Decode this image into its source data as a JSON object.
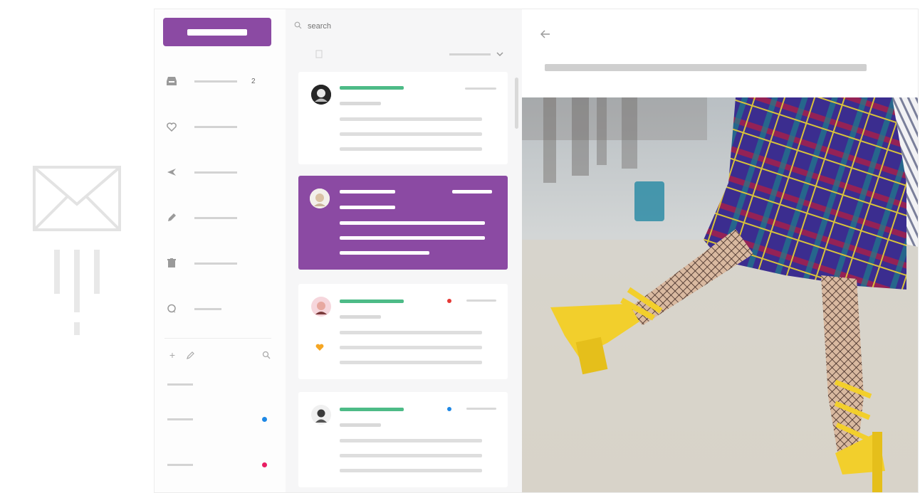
{
  "sidebar": {
    "compose_label": "",
    "nav": [
      {
        "icon": "inbox-icon",
        "count": "2"
      },
      {
        "icon": "heart-icon",
        "count": ""
      },
      {
        "icon": "send-icon",
        "count": ""
      },
      {
        "icon": "pencil-icon",
        "count": ""
      },
      {
        "icon": "trash-icon",
        "count": ""
      },
      {
        "icon": "chat-icon",
        "count": ""
      }
    ],
    "tools": [
      "plus-icon",
      "pencil-icon",
      "search-icon"
    ],
    "folder_dots": [
      "#1e88e5",
      "#e91e63"
    ]
  },
  "list": {
    "search_placeholder": "search",
    "cards": [
      {
        "avatar": "avatar-1",
        "active": false,
        "badge_color": ""
      },
      {
        "avatar": "avatar-2",
        "active": true,
        "badge_color": ""
      },
      {
        "avatar": "avatar-3",
        "active": false,
        "badge_color": "#e53935"
      },
      {
        "avatar": "avatar-4",
        "active": false,
        "badge_color": "#1e88e5"
      }
    ]
  },
  "colors": {
    "accent": "#8b4aa3",
    "sender_green": "#4dbb87",
    "placeholder_gray": "#d3d3d3",
    "heart_orange": "#f5a623"
  }
}
